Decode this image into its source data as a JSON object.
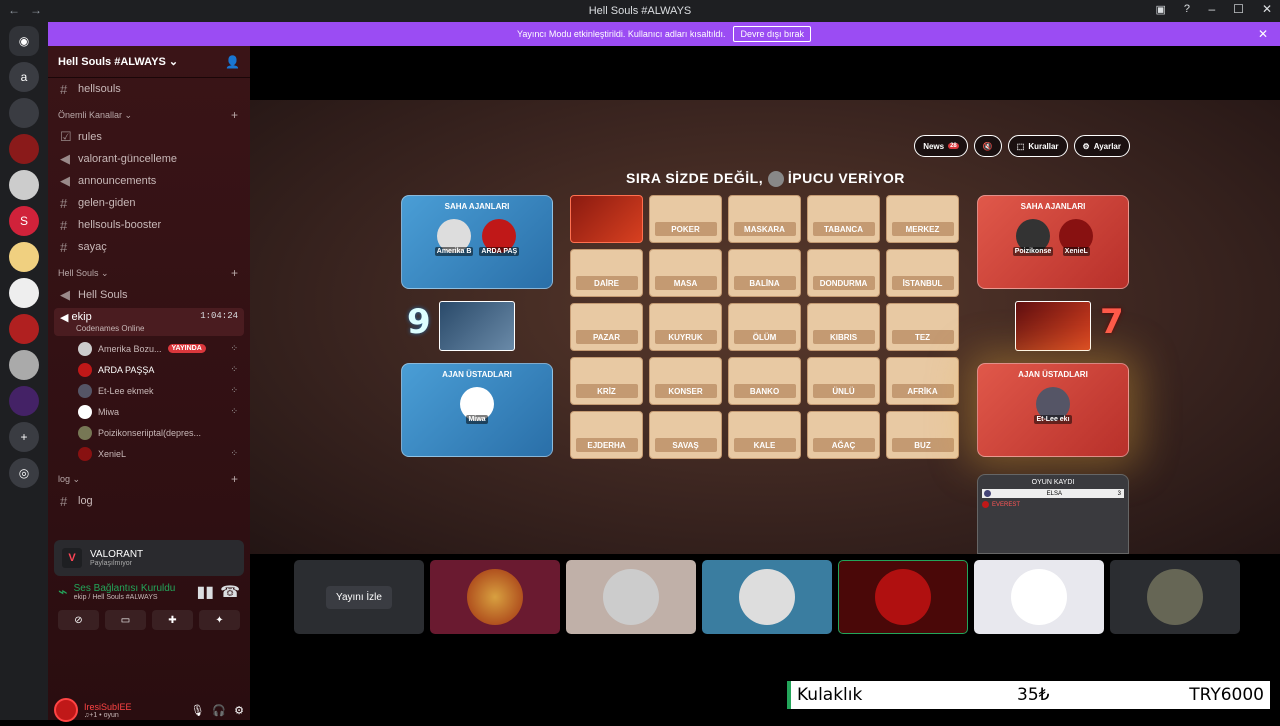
{
  "window": {
    "title": "Hell Souls #ALWAYS"
  },
  "streamer_bar": {
    "message": "Yayıncı Modu etkinleştirildi. Kullanıcı adları kısaltıldı.",
    "button": "Devre dışı bırak"
  },
  "server_rail": {
    "items": [
      "a"
    ]
  },
  "server": {
    "name": "Hell Souls #ALWAYS"
  },
  "channels": {
    "top": "hellsouls",
    "important_category": "Önemli Kanallar",
    "important": [
      "rules",
      "valorant-güncelleme",
      "announcements",
      "gelen-giden",
      "hellsouls-booster",
      "sayaç"
    ],
    "hell_category": "Hell Souls",
    "hell_voice": "Hell Souls",
    "active_voice": {
      "name": "ekip",
      "time": "1:04:24",
      "activity": "Codenames Online"
    },
    "members": [
      {
        "name": "Amerika Bozu...",
        "live": "YAYINDA"
      },
      {
        "name": "ARDA PAŞŞA",
        "live": ""
      },
      {
        "name": "Et-Lee ekmek",
        "live": ""
      },
      {
        "name": "Miwa",
        "live": ""
      },
      {
        "name": "Poizikonseriiptal(depres...",
        "live": ""
      },
      {
        "name": "XenieL",
        "live": ""
      }
    ],
    "log_category": "log",
    "log_channel": "log"
  },
  "activity": {
    "game": "VALORANT",
    "status": "Paylaşılmıyor"
  },
  "voice_connection": {
    "status": "Ses Bağlantısı Kuruldu",
    "location": "ekip / Hell Souls #ALWAYS"
  },
  "user_panel": {
    "name": "IresiSubIEE",
    "status": "♫+1 • oyun"
  },
  "game": {
    "buttons": {
      "news": "News",
      "news_badge": "28",
      "rules": "Kurallar",
      "settings": "Ayarlar"
    },
    "turn_prefix": "SIRA SİZDE DEĞİL,",
    "turn_suffix": "İPUCU VERİYOR",
    "blue": {
      "field_label": "SAHA AJANLARI",
      "field_members": [
        "Amerika B",
        "ARDA PAŞ"
      ],
      "spymaster_label": "AJAN ÜSTADLARI",
      "spymaster": "Miwa",
      "score": "9"
    },
    "red": {
      "field_label": "SAHA AJANLARI",
      "field_members": [
        "Poizikonse",
        "XenieL"
      ],
      "spymaster_label": "AJAN ÜSTADLARI",
      "spymaster": "Et-Lee ekı",
      "score": "7"
    },
    "cards": [
      "",
      "POKER",
      "MASKARA",
      "TABANCA",
      "MERKEZ",
      "DAİRE",
      "MASA",
      "BALİNA",
      "DONDURMA",
      "İSTANBUL",
      "PAZAR",
      "KUYRUK",
      "ÖLÜM",
      "KIBRIS",
      "TEZ",
      "KRİZ",
      "KONSER",
      "BANKO",
      "ÜNLÜ",
      "AFRİKA",
      "EJDERHA",
      "SAVAŞ",
      "KALE",
      "AĞAÇ",
      "BUZ"
    ],
    "log": {
      "title": "OYUN KAYDI",
      "entry_word": "ELSA",
      "entry_count": "3",
      "entry2": "EVEREST"
    }
  },
  "watch_button": "Yayını İzle",
  "ticker": {
    "item": "Kulaklık",
    "price": "35₺",
    "total": "TRY6000"
  }
}
